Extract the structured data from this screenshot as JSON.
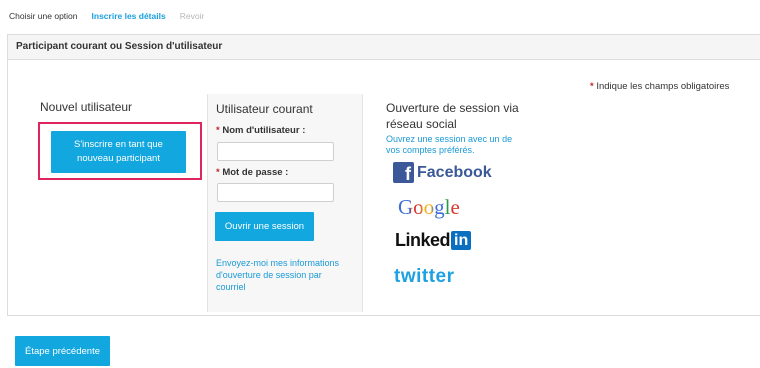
{
  "steps": [
    {
      "label": "Choisir une option",
      "state": "done"
    },
    {
      "label": "Inscrire les détails",
      "state": "active"
    },
    {
      "label": "Revoir",
      "state": "todo"
    }
  ],
  "panel": {
    "title": "Participant courant ou Session d'utilisateur"
  },
  "required_note": {
    "star": "*",
    "text": "Indique les champs obligatoires"
  },
  "new_user": {
    "title": "Nouvel utilisateur",
    "signup_label": "S'inscrire en tant que nouveau participant"
  },
  "current_user": {
    "title": "Utilisateur courant",
    "username_label": "Nom d'utilisateur :",
    "password_label": "Mot de passe :",
    "login_label": "Ouvrir une session",
    "forgot_link": "Envoyez-moi mes informations d'ouverture de session par courriel"
  },
  "social": {
    "title": "Ouverture de session via réseau social",
    "subtitle": "Ouvrez une session avec un de vos comptes préférés.",
    "providers": {
      "facebook": "Facebook",
      "google": "Google",
      "linkedin_a": "Linked",
      "linkedin_b": "in",
      "twitter": "twitter"
    }
  },
  "footer": {
    "prev_label": "Étape précédente"
  },
  "colors": {
    "accent": "#12a7df",
    "link": "#1a9ad6",
    "highlight_frame": "#e0245e",
    "required": "#c0272d",
    "facebook": "#3b5998",
    "linkedin": "#0a6fbf"
  }
}
